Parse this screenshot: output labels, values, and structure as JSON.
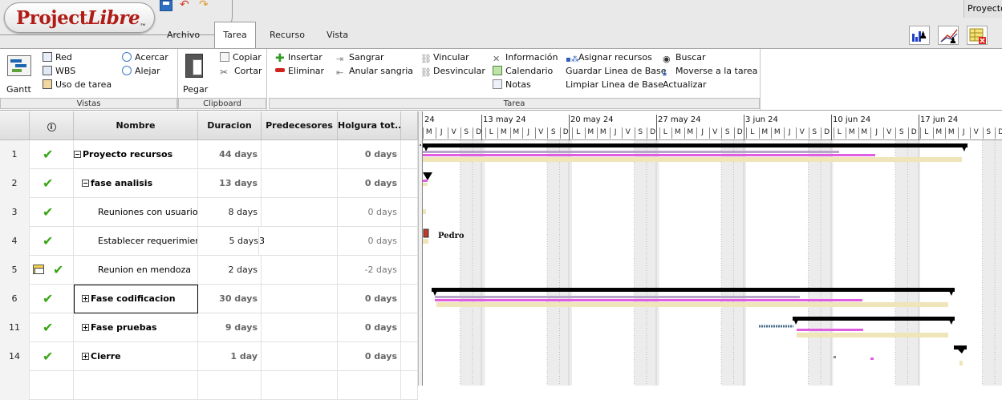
{
  "app": {
    "logo": "ProjectLibre",
    "window_title": "Proyecto"
  },
  "menu": {
    "tabs": [
      "Archivo",
      "Tarea",
      "Recurso",
      "Vista"
    ],
    "active_tab": "Tarea"
  },
  "ribbon": {
    "vistas": {
      "title": "Vistas",
      "gantt": "Gantt",
      "red": "Red",
      "wbs": "WBS",
      "uso_tarea": "Uso de tarea",
      "acercar": "Acercar",
      "alejar": "Alejar"
    },
    "clipboard": {
      "title": "Clipboard",
      "pegar": "Pegar",
      "copiar": "Copiar",
      "cortar": "Cortar"
    },
    "tarea": {
      "title": "Tarea",
      "insertar": "Insertar",
      "eliminar": "Eliminar",
      "sangrar": "Sangrar",
      "anular_sangria": "Anular sangria",
      "vincular": "Vincular",
      "desvincular": "Desvincular",
      "informacion": "Información",
      "calendario": "Calendario",
      "notas": "Notas",
      "asignar_recursos": "Asignar recursos",
      "guardar_linea_base": "Guardar Linea de Base",
      "limpiar_linea_base": "Limpiar Linea de Base",
      "buscar": "Buscar",
      "moverse": "Moverse a la tarea",
      "actualizar": "Actualizar"
    }
  },
  "table": {
    "columns": [
      "Nombre",
      "Duracion",
      "Predecesores",
      "Holgura tot..."
    ],
    "rows": [
      {
        "id": "1",
        "name": "Proyecto recursos",
        "duration": "44 days",
        "pred": "",
        "slack": "0 days"
      },
      {
        "id": "2",
        "name": "fase analisis",
        "duration": "13 days",
        "pred": "",
        "slack": "0 days"
      },
      {
        "id": "3",
        "name": "Reuniones con usuarios",
        "duration": "8 days",
        "pred": "",
        "slack": "0 days"
      },
      {
        "id": "4",
        "name": "Establecer requerimiento",
        "duration": "5 days",
        "pred": "3",
        "slack": "0 days"
      },
      {
        "id": "5",
        "name": "Reunion en mendoza",
        "duration": "2 days",
        "pred": "",
        "slack": "-2 days"
      },
      {
        "id": "6",
        "name": "Fase codificacion",
        "duration": "30 days",
        "pred": "",
        "slack": "0 days"
      },
      {
        "id": "11",
        "name": "Fase pruebas",
        "duration": "9 days",
        "pred": "",
        "slack": "0 days"
      },
      {
        "id": "14",
        "name": "Cierre",
        "duration": "1 day",
        "pred": "",
        "slack": "0 days"
      }
    ]
  },
  "gantt": {
    "weeks": [
      "24",
      "13 may 24",
      "20 may 24",
      "27 may 24",
      "3 jun 24",
      "10 jun 24",
      "17 jun 24"
    ],
    "days": [
      "M",
      "J",
      "V",
      "S",
      "D",
      "L",
      "M",
      "M",
      "J",
      "V",
      "S",
      "D",
      "L",
      "M",
      "M",
      "J",
      "V",
      "S",
      "D",
      "L",
      "M",
      "M",
      "J",
      "V",
      "S",
      "D",
      "L",
      "M",
      "M",
      "J",
      "V",
      "S",
      "D",
      "L",
      "M",
      "M",
      "J",
      "V",
      "S",
      "D",
      "L",
      "M",
      "M",
      "J",
      "V",
      "S",
      "D"
    ],
    "resource_label": "Pedro",
    "colors": {
      "summary": "#000000",
      "progress": "#e05ce0",
      "baseline": "#efe5b8",
      "weekend": "#ececec",
      "link": "#4a6c8c"
    }
  }
}
